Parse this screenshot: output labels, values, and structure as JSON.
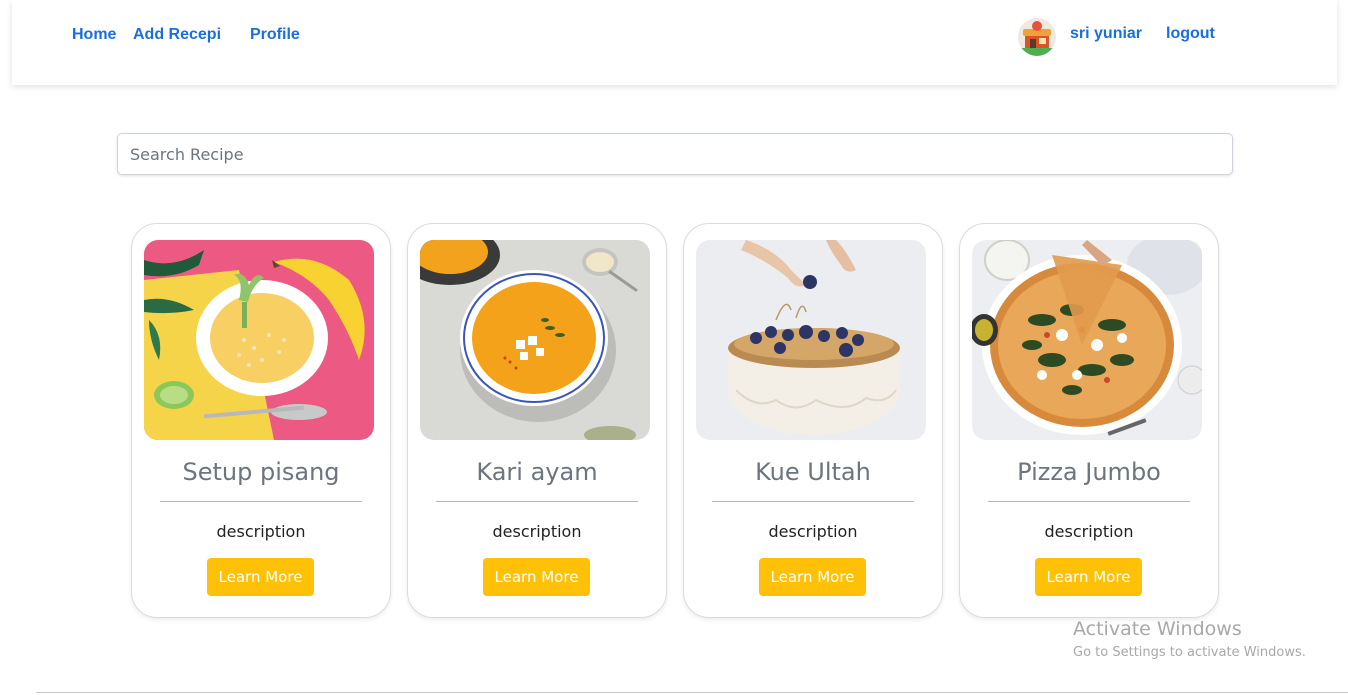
{
  "nav": {
    "home": "Home",
    "add_recipe": "Add Recepi",
    "profile": "Profile",
    "username": "sri yuniar",
    "logout": "logout",
    "accent_color": "#1a6fe0"
  },
  "search": {
    "placeholder": "Search Recipe",
    "value": ""
  },
  "recipes": [
    {
      "title": "Setup pisang",
      "description": "description",
      "button": "Learn More",
      "image": "banana-soup-photo"
    },
    {
      "title": "Kari ayam",
      "description": "description",
      "button": "Learn More",
      "image": "curry-soup-photo"
    },
    {
      "title": "Kue Ultah",
      "description": "description",
      "button": "Learn More",
      "image": "cake-photo"
    },
    {
      "title": "Pizza Jumbo",
      "description": "description",
      "button": "Learn More",
      "image": "pizza-photo"
    }
  ],
  "button_color": "#ffc107",
  "watermark": {
    "title": "Activate Windows",
    "subtitle": "Go to Settings to activate Windows."
  }
}
